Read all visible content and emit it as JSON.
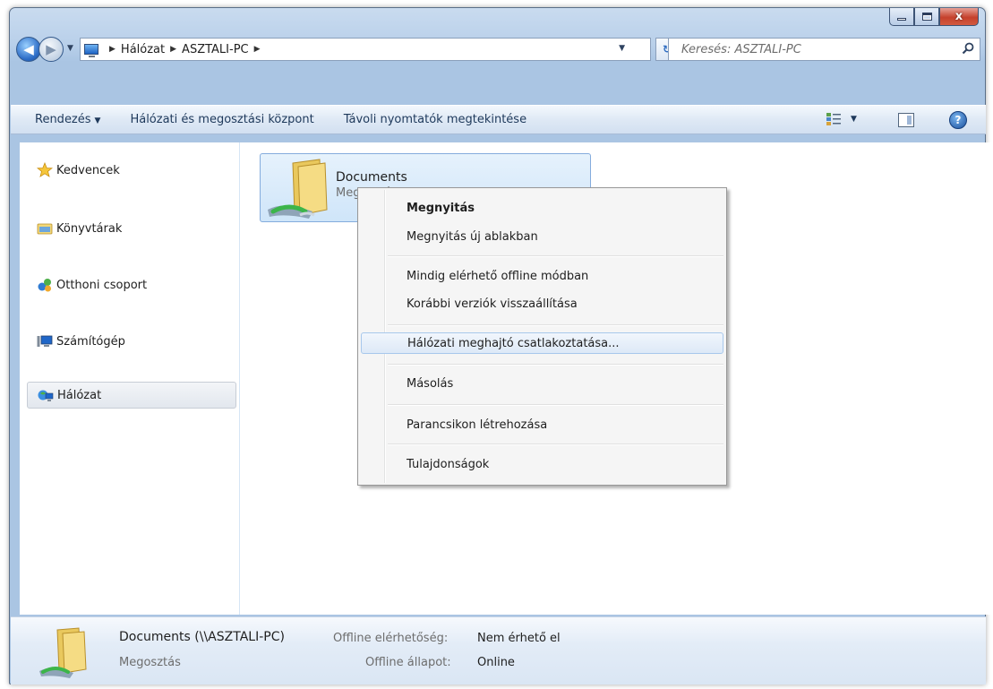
{
  "window": {
    "caption_buttons": [
      "minimize",
      "maximize",
      "close"
    ],
    "close_glyph": "x",
    "minimize_label": "–",
    "maximize_label": "□"
  },
  "nav": {
    "breadcrumbs": [
      "Hálózat",
      "ASZTALI-PC"
    ],
    "search_placeholder": "Keresés: ASZTALI-PC"
  },
  "commands": {
    "organize": "Rendezés",
    "network_center": "Hálózati és megosztási központ",
    "remote_printers": "Távoli nyomtatók megtekintése"
  },
  "sidebar": {
    "items": [
      {
        "label": "Kedvencek",
        "icon": "star-icon"
      },
      {
        "label": "Könyvtárak",
        "icon": "library-icon"
      },
      {
        "label": "Otthoni csoport",
        "icon": "homegroup-icon"
      },
      {
        "label": "Számítógép",
        "icon": "computer-icon"
      },
      {
        "label": "Hálózat",
        "icon": "network-icon",
        "selected": true
      }
    ]
  },
  "share": {
    "name": "Documents",
    "subtitle": "Megosztás"
  },
  "context_menu": {
    "items": [
      {
        "label": "Megnyitás",
        "default": true
      },
      {
        "label": "Megnyitás új ablakban"
      },
      {
        "label": "Mindig elérhető offline módban"
      },
      {
        "label": "Korábbi verziók visszaállítása"
      },
      {
        "label": "Hálózati meghajtó csatlakoztatása...",
        "hover": true
      },
      {
        "label": "Másolás"
      },
      {
        "label": "Parancsikon létrehozása"
      },
      {
        "label": "Tulajdonságok"
      }
    ]
  },
  "details": {
    "title": "Documents (\\\\ASZTALI-PC)",
    "type": "Megosztás",
    "offline_avail_label": "Offline elérhetőség:",
    "offline_avail_value": "Nem érhető el",
    "offline_status_label": "Offline állapot:",
    "offline_status_value": "Online"
  },
  "colors": {
    "accent": "#2c6cc6",
    "folder": "#f2d777",
    "green_arrow": "#3cb54a"
  }
}
